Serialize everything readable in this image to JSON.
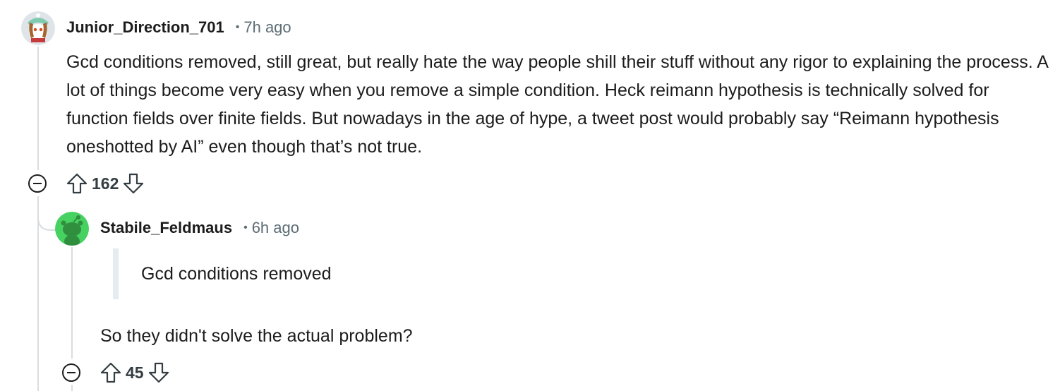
{
  "comments": [
    {
      "username": "Junior_Direction_701",
      "separator": "•",
      "time": "7h ago",
      "body": "Gcd conditions removed, still great, but really hate the way people shill their stuff without any rigor to explaining the process. A lot of things become very easy when you remove a simple condition. Heck reimann hypothesis is technically solved for function fields over finite fields. But nowadays in the age of hype, a tweet post would probably say “Reimann hypothesis oneshotted by AI” even though that’s not true.",
      "score": "162",
      "avatar_icon": "snoo-avatar-icon",
      "upvote_icon": "upvote-arrow-icon",
      "downvote_icon": "downvote-arrow-icon",
      "collapse_icon": "collapse-minus-icon"
    },
    {
      "username": "Stabile_Feldmaus",
      "separator": "•",
      "time": "6h ago",
      "quote": "Gcd conditions removed",
      "body": "So they didn't solve the actual problem?",
      "score": "45",
      "avatar_icon": "snoo-avatar-icon",
      "upvote_icon": "upvote-arrow-icon",
      "downvote_icon": "downvote-arrow-icon",
      "collapse_icon": "collapse-minus-icon"
    }
  ],
  "colors": {
    "text": "#1c1c1c",
    "meta": "#5c6c74",
    "thread_line": "#d9dde0",
    "quote_bar": "#e5ebee",
    "avatar2_bg": "#46d160"
  }
}
